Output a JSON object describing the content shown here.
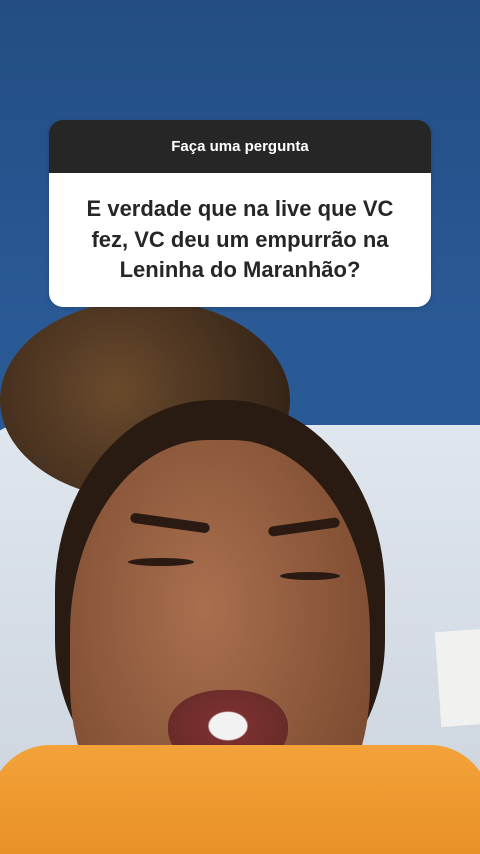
{
  "question_sticker": {
    "header": "Faça uma pergunta",
    "question": "E verdade que na live que VC fez, VC deu um empurrão na Leninha do Maranhão?"
  },
  "colors": {
    "background_wall": "#2a5a96",
    "sticker_header": "#262626",
    "sticker_body": "#ffffff",
    "shirt": "#f3a23a"
  }
}
